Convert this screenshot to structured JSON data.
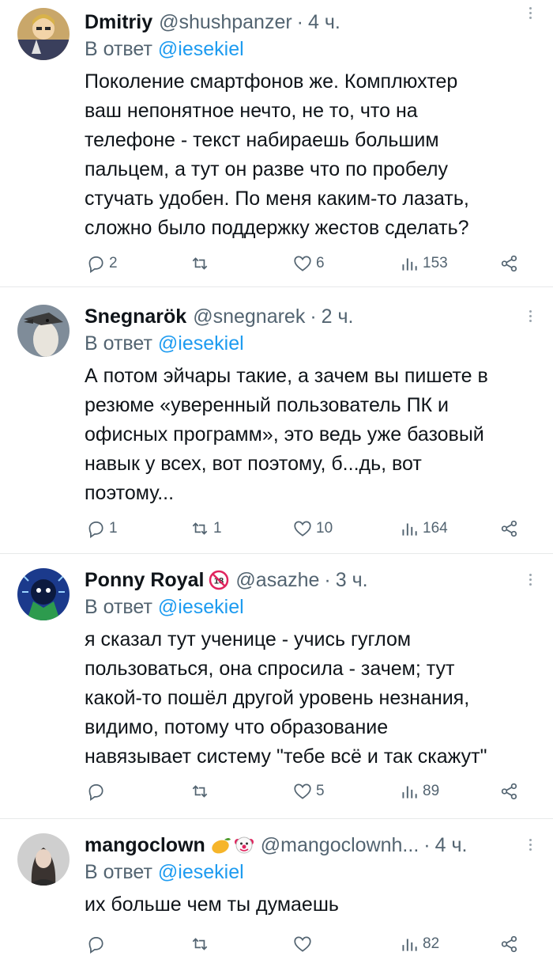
{
  "tweets": [
    {
      "name": "Dmitriy",
      "handle": "@shushpanzer",
      "dot": "·",
      "time": "4 ч.",
      "reply_prefix": "В ответ",
      "reply_to": "@iesekiel",
      "lines": [
        "Поколение смартфонов же. Комплюхтер",
        "ваш непонятное нечто, не то, что на",
        "телефоне - текст набираешь большим",
        "пальцем, а тут он разве что по пробелу",
        "стучать удобен. По меня каким-то лазать,",
        "сложно было поддержку жестов сделать?"
      ],
      "replies": "2",
      "retweets": "",
      "likes": "6",
      "views": "153"
    },
    {
      "name": "Snegnarök",
      "handle": "@snegnarek",
      "dot": "·",
      "time": "2 ч.",
      "reply_prefix": "В ответ",
      "reply_to": "@iesekiel",
      "lines": [
        "А потом эйчары такие, а зачем вы пишете в",
        "резюме «уверенный пользователь ПК и",
        "офисных программ», это ведь уже базовый",
        "навык у всех, вот поэтому, б...дь, вот",
        "поэтому..."
      ],
      "replies": "1",
      "retweets": "1",
      "likes": "10",
      "views": "164"
    },
    {
      "name": "Ponny Royal",
      "handle": "@asazhe",
      "dot": "·",
      "time": "3 ч.",
      "reply_prefix": "В ответ",
      "reply_to": "@iesekiel",
      "lines": [
        "я сказал тут ученице - учись гуглом",
        "пользоваться, она спросила - зачем; тут",
        "какой-то пошёл другой уровень незнания,",
        "видимо, потому что образование",
        "навязывает систему \"тебе всё и так скажут\""
      ],
      "replies": "",
      "retweets": "",
      "likes": "5",
      "views": "89"
    },
    {
      "name": "mangoclown",
      "handle": "@mangoclownh...",
      "dot": "·",
      "time": "4 ч.",
      "reply_prefix": "В ответ",
      "reply_to": "@iesekiel",
      "lines": [
        "их больше чем ты думаешь"
      ],
      "replies": "",
      "retweets": "",
      "likes": "",
      "views": "82"
    }
  ],
  "badges": {
    "age_restriction": "18"
  },
  "colors": {
    "link": "#1d9bf0",
    "secondary": "#536471",
    "text": "#0f1419",
    "divider": "#e7e9ea"
  },
  "icons": [
    "reply-icon",
    "retweet-icon",
    "like-icon",
    "views-icon",
    "share-icon",
    "more-icon",
    "age-restriction-icon",
    "mango-emoji-icon",
    "clown-emoji-icon"
  ]
}
